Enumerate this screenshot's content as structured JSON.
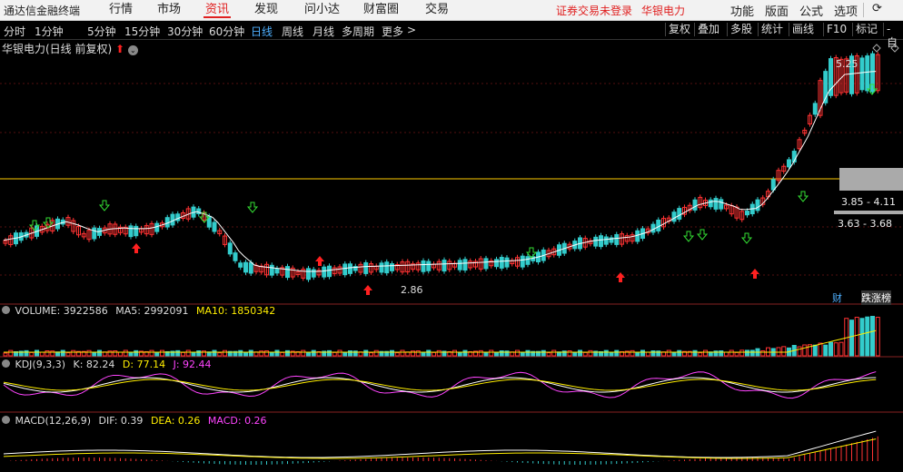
{
  "topbar": {
    "app_name": "通达信金融终端",
    "tabs": [
      "行情",
      "市场",
      "资讯",
      "发现",
      "问小达",
      "财富圈",
      "交易"
    ],
    "active_tab": "资讯",
    "warning": "证券交易未登录",
    "stock_name": "华银电力",
    "right_tabs": [
      "功能",
      "版面",
      "公式",
      "选项"
    ]
  },
  "periodbar": {
    "periods": [
      "分时",
      "1分钟",
      "5分钟",
      "15分钟",
      "30分钟",
      "60分钟",
      "日线",
      "周线",
      "月线",
      "多周期",
      "更多"
    ],
    "active_period": "日线",
    "more_arrow": ">",
    "right_buttons": [
      "复权",
      "叠加",
      "多股",
      "统计",
      "画线",
      "F10",
      "标记",
      "-自"
    ]
  },
  "main_chart": {
    "title": "华银电力(日线 前复权)",
    "high_label": "5.25",
    "low_label": "2.86",
    "range_box_upper": "3.85 - 4.11",
    "range_box_lower": "3.63 - 3.68",
    "badge_cai": "财",
    "badge_zhangdie": "跌涨榜",
    "colors": {
      "up": "#ff3333",
      "down": "#33cccc",
      "ma": "#ffffff",
      "level": "#ffcc00",
      "arrow_up": "#ff2020",
      "arrow_down": "#33dd33"
    }
  },
  "volume_panel": {
    "name": "VOLUME: 3922586",
    "ma5": "MA5: 2992091",
    "ma10": "MA10: 1850342"
  },
  "kdj_panel": {
    "name": "KDJ(9,3,3)",
    "k": "K: 82.24",
    "d": "D: 77.14",
    "j": "J: 92.44"
  },
  "macd_panel": {
    "name": "MACD(12,26,9)",
    "dif": "DIF: 0.39",
    "dea": "DEA: 0.26",
    "macd": "MACD: 0.26"
  }
}
